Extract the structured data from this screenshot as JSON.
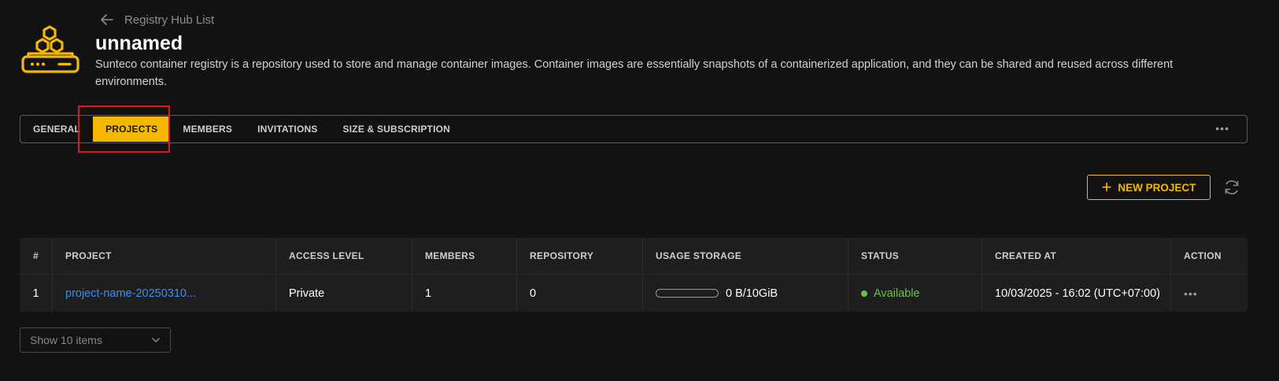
{
  "breadcrumb": {
    "back_label": "Registry Hub List"
  },
  "registry": {
    "name": "unnamed",
    "description": "Sunteco container registry is a repository used to store and manage container images. Container images are essentially snapshots of a containerized application, and they can be shared and reused across different environments."
  },
  "tabs": [
    {
      "label": "GENERAL",
      "active": false
    },
    {
      "label": "PROJECTS",
      "active": true
    },
    {
      "label": "MEMBERS",
      "active": false
    },
    {
      "label": "INVITATIONS",
      "active": false
    },
    {
      "label": "SIZE & SUBSCRIPTION",
      "active": false
    }
  ],
  "tabs_more_label": "•••",
  "toolbar": {
    "new_project_label": "NEW PROJECT",
    "refresh_icon": "refresh-icon"
  },
  "table": {
    "columns": [
      "#",
      "PROJECT",
      "ACCESS LEVEL",
      "MEMBERS",
      "REPOSITORY",
      "USAGE STORAGE",
      "STATUS",
      "CREATED AT",
      "ACTION"
    ],
    "rows": [
      {
        "index": "1",
        "project": "project-name-20250310...",
        "access_level": "Private",
        "members": "1",
        "repository": "0",
        "usage_storage": "0 B/10GiB",
        "usage_fraction": 0,
        "status": "Available",
        "created_at": "10/03/2025 - 16:02 (UTC+07:00)",
        "action": "•••"
      }
    ]
  },
  "pagination": {
    "page_size_label": "Show 10 items"
  },
  "colors": {
    "accent": "#f5b800",
    "link": "#3b8ff0",
    "status_available": "#6cc04a",
    "highlight": "#e0161f"
  }
}
